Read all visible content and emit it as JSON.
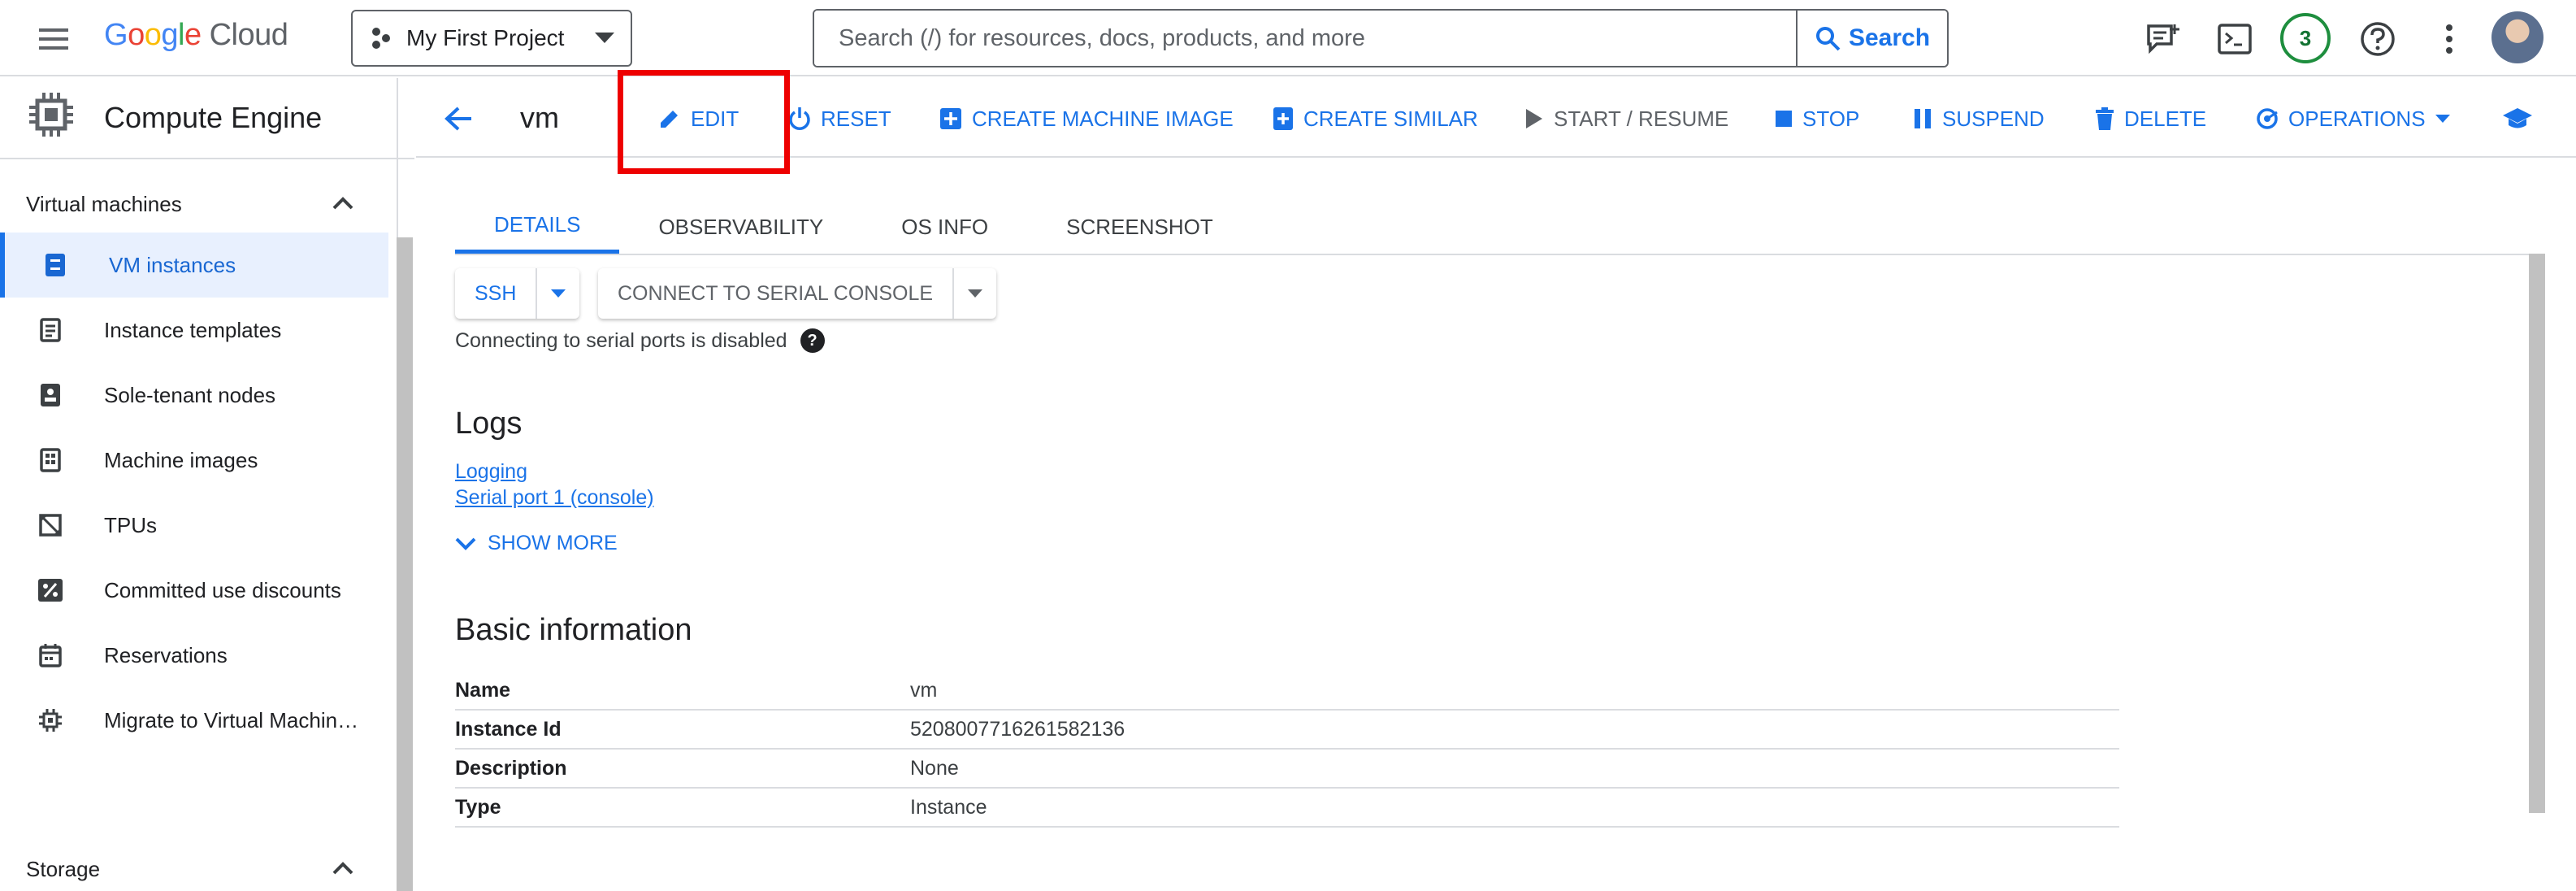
{
  "topbar": {
    "logo_letters": [
      "G",
      "o",
      "o",
      "g",
      "l",
      "e"
    ],
    "logo_suffix": "Cloud",
    "project": "My First Project",
    "search_placeholder": "Search (/) for resources, docs, products, and more",
    "search_button": "Search",
    "notification_count": "3"
  },
  "sidebar": {
    "product_title": "Compute Engine",
    "section_vm": "Virtual machines",
    "items": [
      {
        "label": "VM instances",
        "icon": "vm-instances-icon"
      },
      {
        "label": "Instance templates",
        "icon": "template-icon"
      },
      {
        "label": "Sole-tenant nodes",
        "icon": "sole-tenant-icon"
      },
      {
        "label": "Machine images",
        "icon": "machine-image-icon"
      },
      {
        "label": "TPUs",
        "icon": "tpu-icon"
      },
      {
        "label": "Committed use discounts",
        "icon": "percent-icon"
      },
      {
        "label": "Reservations",
        "icon": "calendar-icon"
      },
      {
        "label": "Migrate to Virtual Machin…",
        "icon": "migrate-icon"
      }
    ],
    "section_storage": "Storage"
  },
  "actionbar": {
    "title": "vm",
    "edit": "EDIT",
    "reset": "RESET",
    "create_machine_image": "CREATE MACHINE IMAGE",
    "create_similar": "CREATE SIMILAR",
    "start_resume": "START / RESUME",
    "stop": "STOP",
    "suspend": "SUSPEND",
    "delete": "DELETE",
    "operations": "OPERATIONS"
  },
  "tabs": [
    "DETAILS",
    "OBSERVABILITY",
    "OS INFO",
    "SCREENSHOT"
  ],
  "connect": {
    "ssh": "SSH",
    "serial": "CONNECT TO SERIAL CONSOLE",
    "hint": "Connecting to serial ports is disabled"
  },
  "logs": {
    "heading": "Logs",
    "logging_link": "Logging",
    "serial_link": "Serial port 1 (console)",
    "show_more": "SHOW MORE"
  },
  "basic_info": {
    "heading": "Basic information",
    "rows": [
      {
        "key": "Name",
        "value": "vm"
      },
      {
        "key": "Instance Id",
        "value": "5208007716261582136"
      },
      {
        "key": "Description",
        "value": "None"
      },
      {
        "key": "Type",
        "value": "Instance"
      }
    ]
  },
  "colors": {
    "accent": "#1a73e8",
    "highlight": "#ee0000",
    "status_green": "#1e8e3e"
  }
}
